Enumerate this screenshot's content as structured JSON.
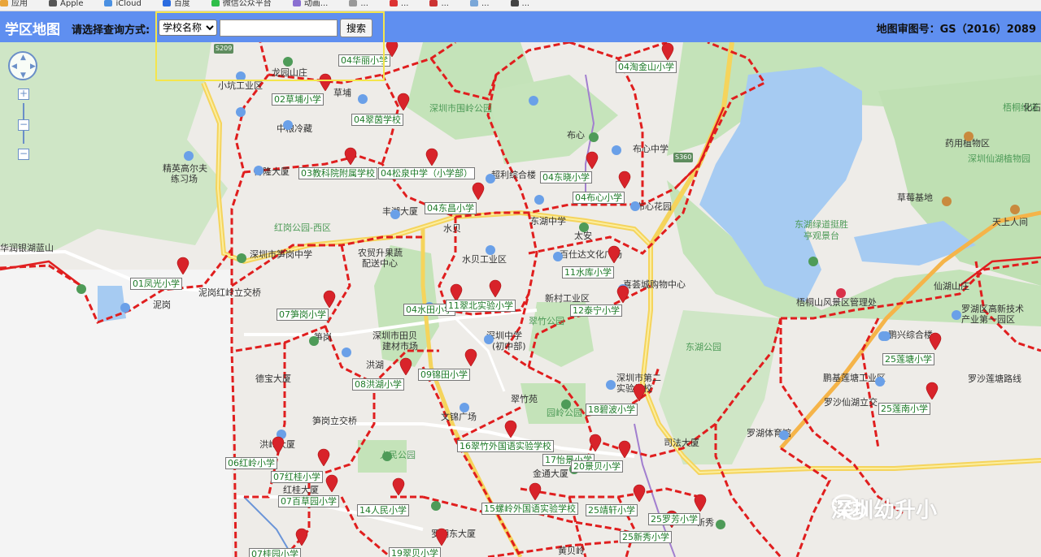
{
  "bookmarks": [
    "应用",
    "Apple",
    "iCloud",
    "百度",
    "微信公众平台",
    "动画...",
    "...",
    "...",
    "...",
    "...",
    "..."
  ],
  "header": {
    "title": "学区地图",
    "query_label": "请选择查询方式:",
    "select_value": "学校名称",
    "search_value": "",
    "search_button": "搜索",
    "approval": "地图审图号：GS（2016）2089"
  },
  "map_labels": [
    {
      "text": "S209",
      "kind": "road"
    },
    {
      "text": "龙园山庄",
      "kind": "plain"
    },
    {
      "text": "小坑工业区",
      "kind": "plain"
    },
    {
      "text": "草埔",
      "kind": "plain"
    },
    {
      "text": "中粮冷藏",
      "kind": "plain"
    },
    {
      "text": "深圳市围岭公园",
      "kind": "park"
    },
    {
      "text": "布心",
      "kind": "plain"
    },
    {
      "text": "布心中学",
      "kind": "plain"
    },
    {
      "text": "S360",
      "kind": "road"
    },
    {
      "text": "药用植物区",
      "kind": "plain"
    },
    {
      "text": "深圳仙湖植物园",
      "kind": "park"
    },
    {
      "text": "草莓基地",
      "kind": "plain"
    },
    {
      "text": "天上人间",
      "kind": "plain"
    },
    {
      "text": "东湖绿道挺胜",
      "kind": "park"
    },
    {
      "text": "亭观景台",
      "kind": "park"
    },
    {
      "text": "精英高尔夫",
      "kind": "plain"
    },
    {
      "text": "练习场",
      "kind": "plain"
    },
    {
      "text": "博隆大厦",
      "kind": "plain"
    },
    {
      "text": "超利综合楼",
      "kind": "plain"
    },
    {
      "text": "丰湖大厦",
      "kind": "plain"
    },
    {
      "text": "布心花园",
      "kind": "plain"
    },
    {
      "text": "东湖中学",
      "kind": "plain"
    },
    {
      "text": "太安",
      "kind": "plain"
    },
    {
      "text": "水贝",
      "kind": "plain"
    },
    {
      "text": "红岗公园-西区",
      "kind": "park"
    },
    {
      "text": "华润银湖蓝山",
      "kind": "plain"
    },
    {
      "text": "深圳市笋岗中学",
      "kind": "plain"
    },
    {
      "text": "农贸升果蔬",
      "kind": "plain"
    },
    {
      "text": "配送中心",
      "kind": "plain"
    },
    {
      "text": "水贝工业区",
      "kind": "plain"
    },
    {
      "text": "百仕达文化广场",
      "kind": "plain"
    },
    {
      "text": "喜荟城购物中心",
      "kind": "plain"
    },
    {
      "text": "新村工业区",
      "kind": "plain"
    },
    {
      "text": "仙湖山庄",
      "kind": "plain"
    },
    {
      "text": "梧桐山风景区管理处",
      "kind": "plain"
    },
    {
      "text": "罗湖区高新技术",
      "kind": "plain"
    },
    {
      "text": "产业第一园区",
      "kind": "plain"
    },
    {
      "text": "鹏兴综合楼",
      "kind": "plain"
    },
    {
      "text": "泥岗",
      "kind": "plain"
    },
    {
      "text": "泥岗红岭立交桥",
      "kind": "plain"
    },
    {
      "text": "笋岗",
      "kind": "plain"
    },
    {
      "text": "深圳市田贝",
      "kind": "plain"
    },
    {
      "text": "建材市场",
      "kind": "plain"
    },
    {
      "text": "深圳中学",
      "kind": "plain"
    },
    {
      "text": "(初中部)",
      "kind": "plain"
    },
    {
      "text": "翠竹公园",
      "kind": "park"
    },
    {
      "text": "东湖公园",
      "kind": "park"
    },
    {
      "text": "鹏基莲塘工业区",
      "kind": "plain"
    },
    {
      "text": "罗沙莲塘路线",
      "kind": "plain"
    },
    {
      "text": "罗沙仙湖立交",
      "kind": "plain"
    },
    {
      "text": "德宝大厦",
      "kind": "plain"
    },
    {
      "text": "洪湖",
      "kind": "plain"
    },
    {
      "text": "深圳市第二",
      "kind": "plain"
    },
    {
      "text": "实验学校",
      "kind": "plain"
    },
    {
      "text": "翠竹苑",
      "kind": "plain"
    },
    {
      "text": "园岭公园",
      "kind": "park"
    },
    {
      "text": "文锦广场",
      "kind": "plain"
    },
    {
      "text": "罗湖体育馆",
      "kind": "plain"
    },
    {
      "text": "司法大厦",
      "kind": "plain"
    },
    {
      "text": "人民公园",
      "kind": "park"
    },
    {
      "text": "金通大厦",
      "kind": "plain"
    },
    {
      "text": "黄贝岭",
      "kind": "plain"
    },
    {
      "text": "新秀",
      "kind": "plain"
    },
    {
      "text": "洪岭大厦",
      "kind": "plain"
    },
    {
      "text": "红桂大厦",
      "kind": "plain"
    },
    {
      "text": "笋岗立交桥",
      "kind": "plain"
    },
    {
      "text": "梧桐绿道",
      "kind": "park"
    },
    {
      "text": "化石",
      "kind": "plain"
    },
    {
      "text": "罗湖东大厦",
      "kind": "plain"
    }
  ],
  "schools": [
    "04华丽小学",
    "04淘金山小学",
    "02草埔小学",
    "04翠茵学校",
    "03教科院附属学校",
    "04松泉中学（小学部）",
    "04东晓小学",
    "04布心小学",
    "04东昌小学",
    "01凤光小学",
    "11水库小学",
    "07笋岗小学",
    "04水田小学",
    "11翠北实验小学",
    "12泰宁小学",
    "25莲塘小学",
    "08洪湖小学",
    "09锦田小学",
    "25莲南小学",
    "18碧波小学",
    "16翠竹外国语实验学校",
    "06红岭小学",
    "17怡景小学",
    "20景贝小学",
    "07红桂小学",
    "07百草园小学",
    "14人民小学",
    "15螺岭外国语实验学校",
    "25靖轩小学",
    "25罗芳小学",
    "25新秀小学",
    "07桂园小学",
    "19翠贝小学"
  ],
  "map_controls": {
    "zoom_in": "+",
    "zoom_out": "−",
    "mid": "−"
  },
  "watermark": "深圳幼升小",
  "colors": {
    "boundary": "#e01e1e",
    "highway": "#f5d45c",
    "header": "#5f8ff0",
    "water": "#a6cbf2",
    "park": "#c4e3b9"
  }
}
